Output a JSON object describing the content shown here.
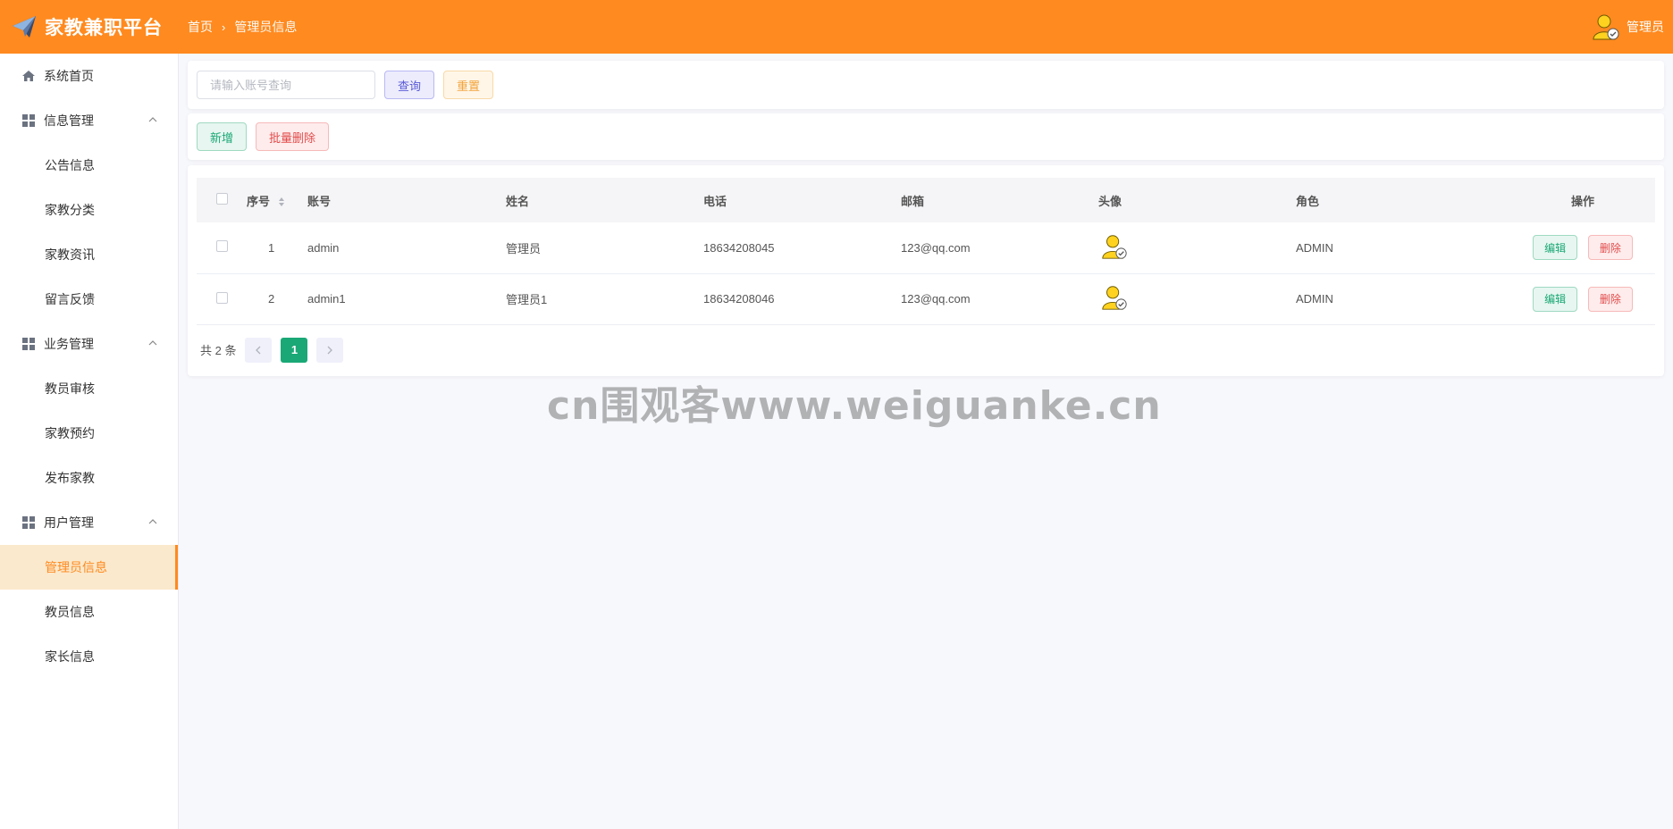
{
  "header": {
    "app_title": "家教兼职平台",
    "breadcrumb": [
      "首页",
      "管理员信息"
    ],
    "user_name": "管理员"
  },
  "sidebar": {
    "home": "系统首页",
    "groups": [
      {
        "label": "信息管理",
        "items": [
          "公告信息",
          "家教分类",
          "家教资讯",
          "留言反馈"
        ]
      },
      {
        "label": "业务管理",
        "items": [
          "教员审核",
          "家教预约",
          "发布家教"
        ]
      },
      {
        "label": "用户管理",
        "items": [
          "管理员信息",
          "教员信息",
          "家长信息"
        ]
      }
    ],
    "active": "管理员信息"
  },
  "search": {
    "placeholder": "请输入账号查询",
    "query_label": "查询",
    "reset_label": "重置"
  },
  "actions": {
    "add_label": "新增",
    "batch_delete_label": "批量删除"
  },
  "table": {
    "columns": [
      "序号",
      "账号",
      "姓名",
      "电话",
      "邮箱",
      "头像",
      "角色",
      "操作"
    ],
    "rows": [
      {
        "index": "1",
        "account": "admin",
        "name": "管理员",
        "phone": "18634208045",
        "email": "123@qq.com",
        "role": "ADMIN"
      },
      {
        "index": "2",
        "account": "admin1",
        "name": "管理员1",
        "phone": "18634208046",
        "email": "123@qq.com",
        "role": "ADMIN"
      }
    ],
    "edit_label": "编辑",
    "delete_label": "删除"
  },
  "pagination": {
    "total_text": "共 2 条",
    "current_page": "1"
  },
  "watermark": "cn围观客www.weiguanke.cn",
  "colors": {
    "brand": "#ff8a1f",
    "success": "#1aa876",
    "danger": "#e24c4c"
  }
}
